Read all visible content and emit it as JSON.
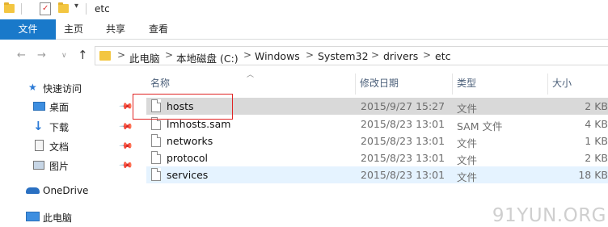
{
  "window": {
    "title": "etc"
  },
  "ribbon": {
    "file_tab": "文件",
    "tabs": [
      "主页",
      "共享",
      "查看"
    ]
  },
  "address": {
    "crumbs": [
      "此电脑",
      "本地磁盘 (C:)",
      "Windows",
      "System32",
      "drivers",
      "etc"
    ],
    "separator": ">"
  },
  "nav": {
    "quick_access": "快速访问",
    "items": [
      {
        "label": "桌面",
        "icon": "desktop-icon",
        "pinned": true
      },
      {
        "label": "下载",
        "icon": "download-icon",
        "pinned": true
      },
      {
        "label": "文档",
        "icon": "documents-icon",
        "pinned": true
      },
      {
        "label": "图片",
        "icon": "pictures-icon",
        "pinned": true
      }
    ],
    "onedrive": "OneDrive",
    "this_pc": "此电脑"
  },
  "columns": {
    "name": "名称",
    "date": "修改日期",
    "type": "类型",
    "size": "大小"
  },
  "files": [
    {
      "name": "hosts",
      "date": "2015/9/27 15:27",
      "type": "文件",
      "size": "2 KB",
      "state": "selected"
    },
    {
      "name": "lmhosts.sam",
      "date": "2015/8/23 13:01",
      "type": "SAM 文件",
      "size": "4 KB",
      "state": "normal"
    },
    {
      "name": "networks",
      "date": "2015/8/23 13:01",
      "type": "文件",
      "size": "1 KB",
      "state": "normal"
    },
    {
      "name": "protocol",
      "date": "2015/8/23 13:01",
      "type": "文件",
      "size": "2 KB",
      "state": "normal"
    },
    {
      "name": "services",
      "date": "2015/8/23 13:01",
      "type": "文件",
      "size": "18 KB",
      "state": "hover"
    }
  ],
  "watermark": "91YUN.ORG",
  "colors": {
    "accent": "#1979ca",
    "highlight": "#e02424",
    "folder": "#f3c641"
  }
}
